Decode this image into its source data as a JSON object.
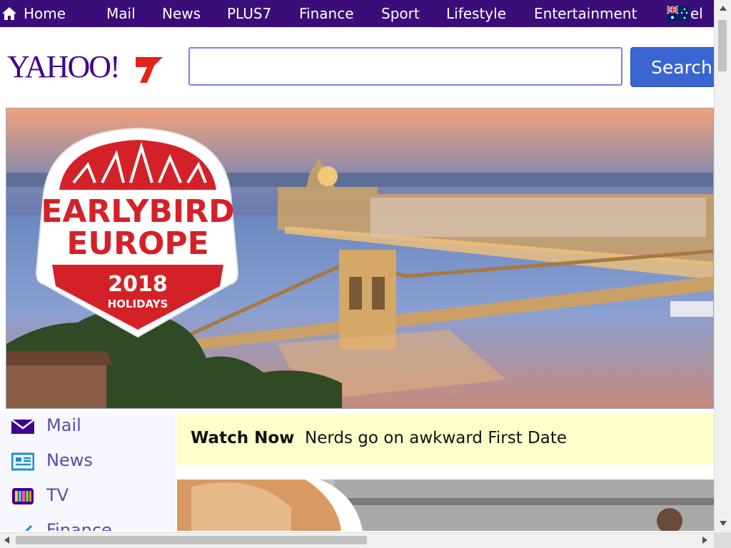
{
  "topnav": {
    "home_label": "Home",
    "items": [
      "Mail",
      "News",
      "PLUS7",
      "Finance",
      "Sport",
      "Lifestyle",
      "Entertainment"
    ],
    "flag_label": "vel",
    "background": "#3b0d78"
  },
  "header": {
    "logo_text": "YAHOO!",
    "search_placeholder": "",
    "search_button": "Search"
  },
  "hero": {
    "badge_line1": "EARLYBIRD",
    "badge_line2": "EUROPE",
    "badge_year": "2018",
    "badge_sub": "HOLIDAYS"
  },
  "sidebar": {
    "items": [
      {
        "label": "Mail",
        "icon": "mail-icon"
      },
      {
        "label": "News",
        "icon": "news-icon"
      },
      {
        "label": "TV",
        "icon": "tv-icon"
      },
      {
        "label": "Finance",
        "icon": "finance-icon"
      }
    ]
  },
  "watch": {
    "title": "Watch Now",
    "text": "Nerds go on awkward First Date"
  },
  "colors": {
    "brand_purple": "#400090",
    "search_blue": "#3a66d2",
    "seven_red": "#e2231a"
  }
}
